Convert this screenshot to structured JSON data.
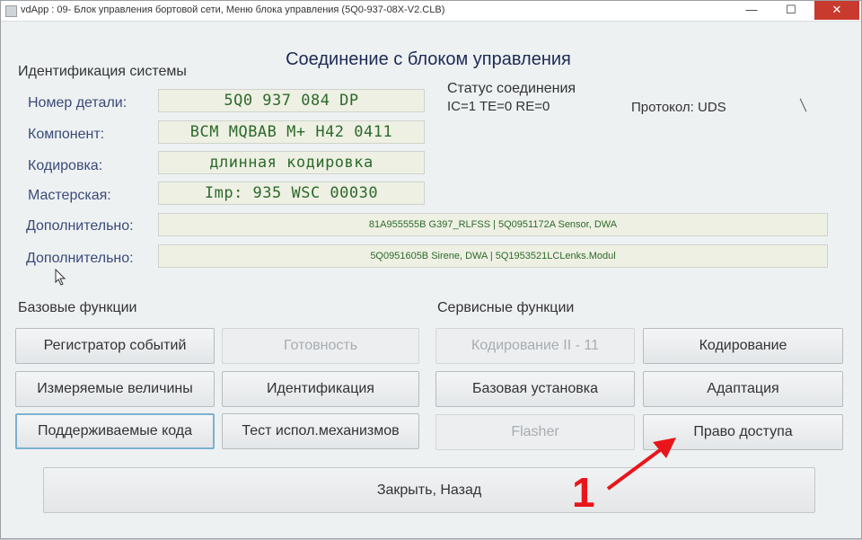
{
  "window": {
    "title": "vdApp : 09- Блок управления бортовой сети,  Меню блока управления (5Q0-937-08X-V2.CLB)",
    "minimize_glyph": "—",
    "maximize_glyph": "☐",
    "close_glyph": "✕"
  },
  "header": {
    "title": "Соединение с блоком управления"
  },
  "identification": {
    "section_label": "Идентификация системы",
    "fields": [
      {
        "label": "Номер детали:",
        "value": "5Q0 937 084 DP"
      },
      {
        "label": "Компонент:",
        "value": "BCM MQBAB M+  H42 0411"
      },
      {
        "label": "Кодировка:",
        "value": "длинная кодировка"
      },
      {
        "label": "Мастерская:",
        "value": "Imp: 935     WSC 00030"
      },
      {
        "label": "Дополнительно:",
        "value": "81A955555B G397_RLFSS  |  5Q0951172A Sensor, DWA"
      },
      {
        "label": "Дополнительно:",
        "value": "5Q0951605B Sirene, DWA  |  5Q1953521LCLenks.Modul"
      }
    ]
  },
  "status": {
    "title": "Статус соединения",
    "line": "IC=1  TE=0   RE=0",
    "protocol": "Протокол: UDS"
  },
  "basic_functions": {
    "label": "Базовые функции",
    "buttons": [
      {
        "label": "Регистратор событий",
        "state": "enabled"
      },
      {
        "label": "Готовность",
        "state": "disabled"
      },
      {
        "label": "Измеряемые величины",
        "state": "enabled"
      },
      {
        "label": "Идентификация",
        "state": "enabled"
      },
      {
        "label": "Поддерживаемые кода",
        "state": "selected"
      },
      {
        "label": "Тест испол.механизмов",
        "state": "enabled"
      }
    ]
  },
  "service_functions": {
    "label": "Сервисные функции",
    "buttons": [
      {
        "label": "Кодирование II - 11",
        "state": "disabled"
      },
      {
        "label": "Кодирование",
        "state": "enabled"
      },
      {
        "label": "Базовая установка",
        "state": "enabled"
      },
      {
        "label": "Адаптация",
        "state": "enabled"
      },
      {
        "label": "Flasher",
        "state": "disabled"
      },
      {
        "label": "Право доступа",
        "state": "enabled"
      }
    ]
  },
  "footer": {
    "close_label": "Закрыть, Назад"
  },
  "annotation": {
    "number": "1",
    "color": "#e8161b"
  },
  "colors": {
    "value_text": "#2d6a2b",
    "label_text": "#3a4a78",
    "title_text": "#1c2a55"
  }
}
